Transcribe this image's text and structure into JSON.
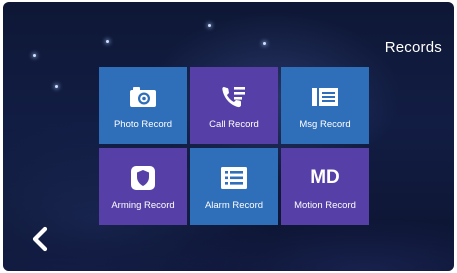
{
  "header": {
    "title": "Records"
  },
  "tiles": [
    {
      "label": "Photo Record",
      "icon": "camera-icon",
      "color": "#2f6fba"
    },
    {
      "label": "Call Record",
      "icon": "call-log-icon",
      "color": "#5640a8"
    },
    {
      "label": "Msg Record",
      "icon": "message-list-icon",
      "color": "#2f6fba"
    },
    {
      "label": "Arming Record",
      "icon": "shield-icon",
      "color": "#5640a8"
    },
    {
      "label": "Alarm Record",
      "icon": "alarm-list-icon",
      "color": "#2f6fba"
    },
    {
      "label": "Motion Record",
      "icon": "md-text-icon",
      "color": "#5640a8",
      "icon_text": "MD"
    }
  ],
  "footer": {
    "back_icon": "chevron-left-icon"
  }
}
